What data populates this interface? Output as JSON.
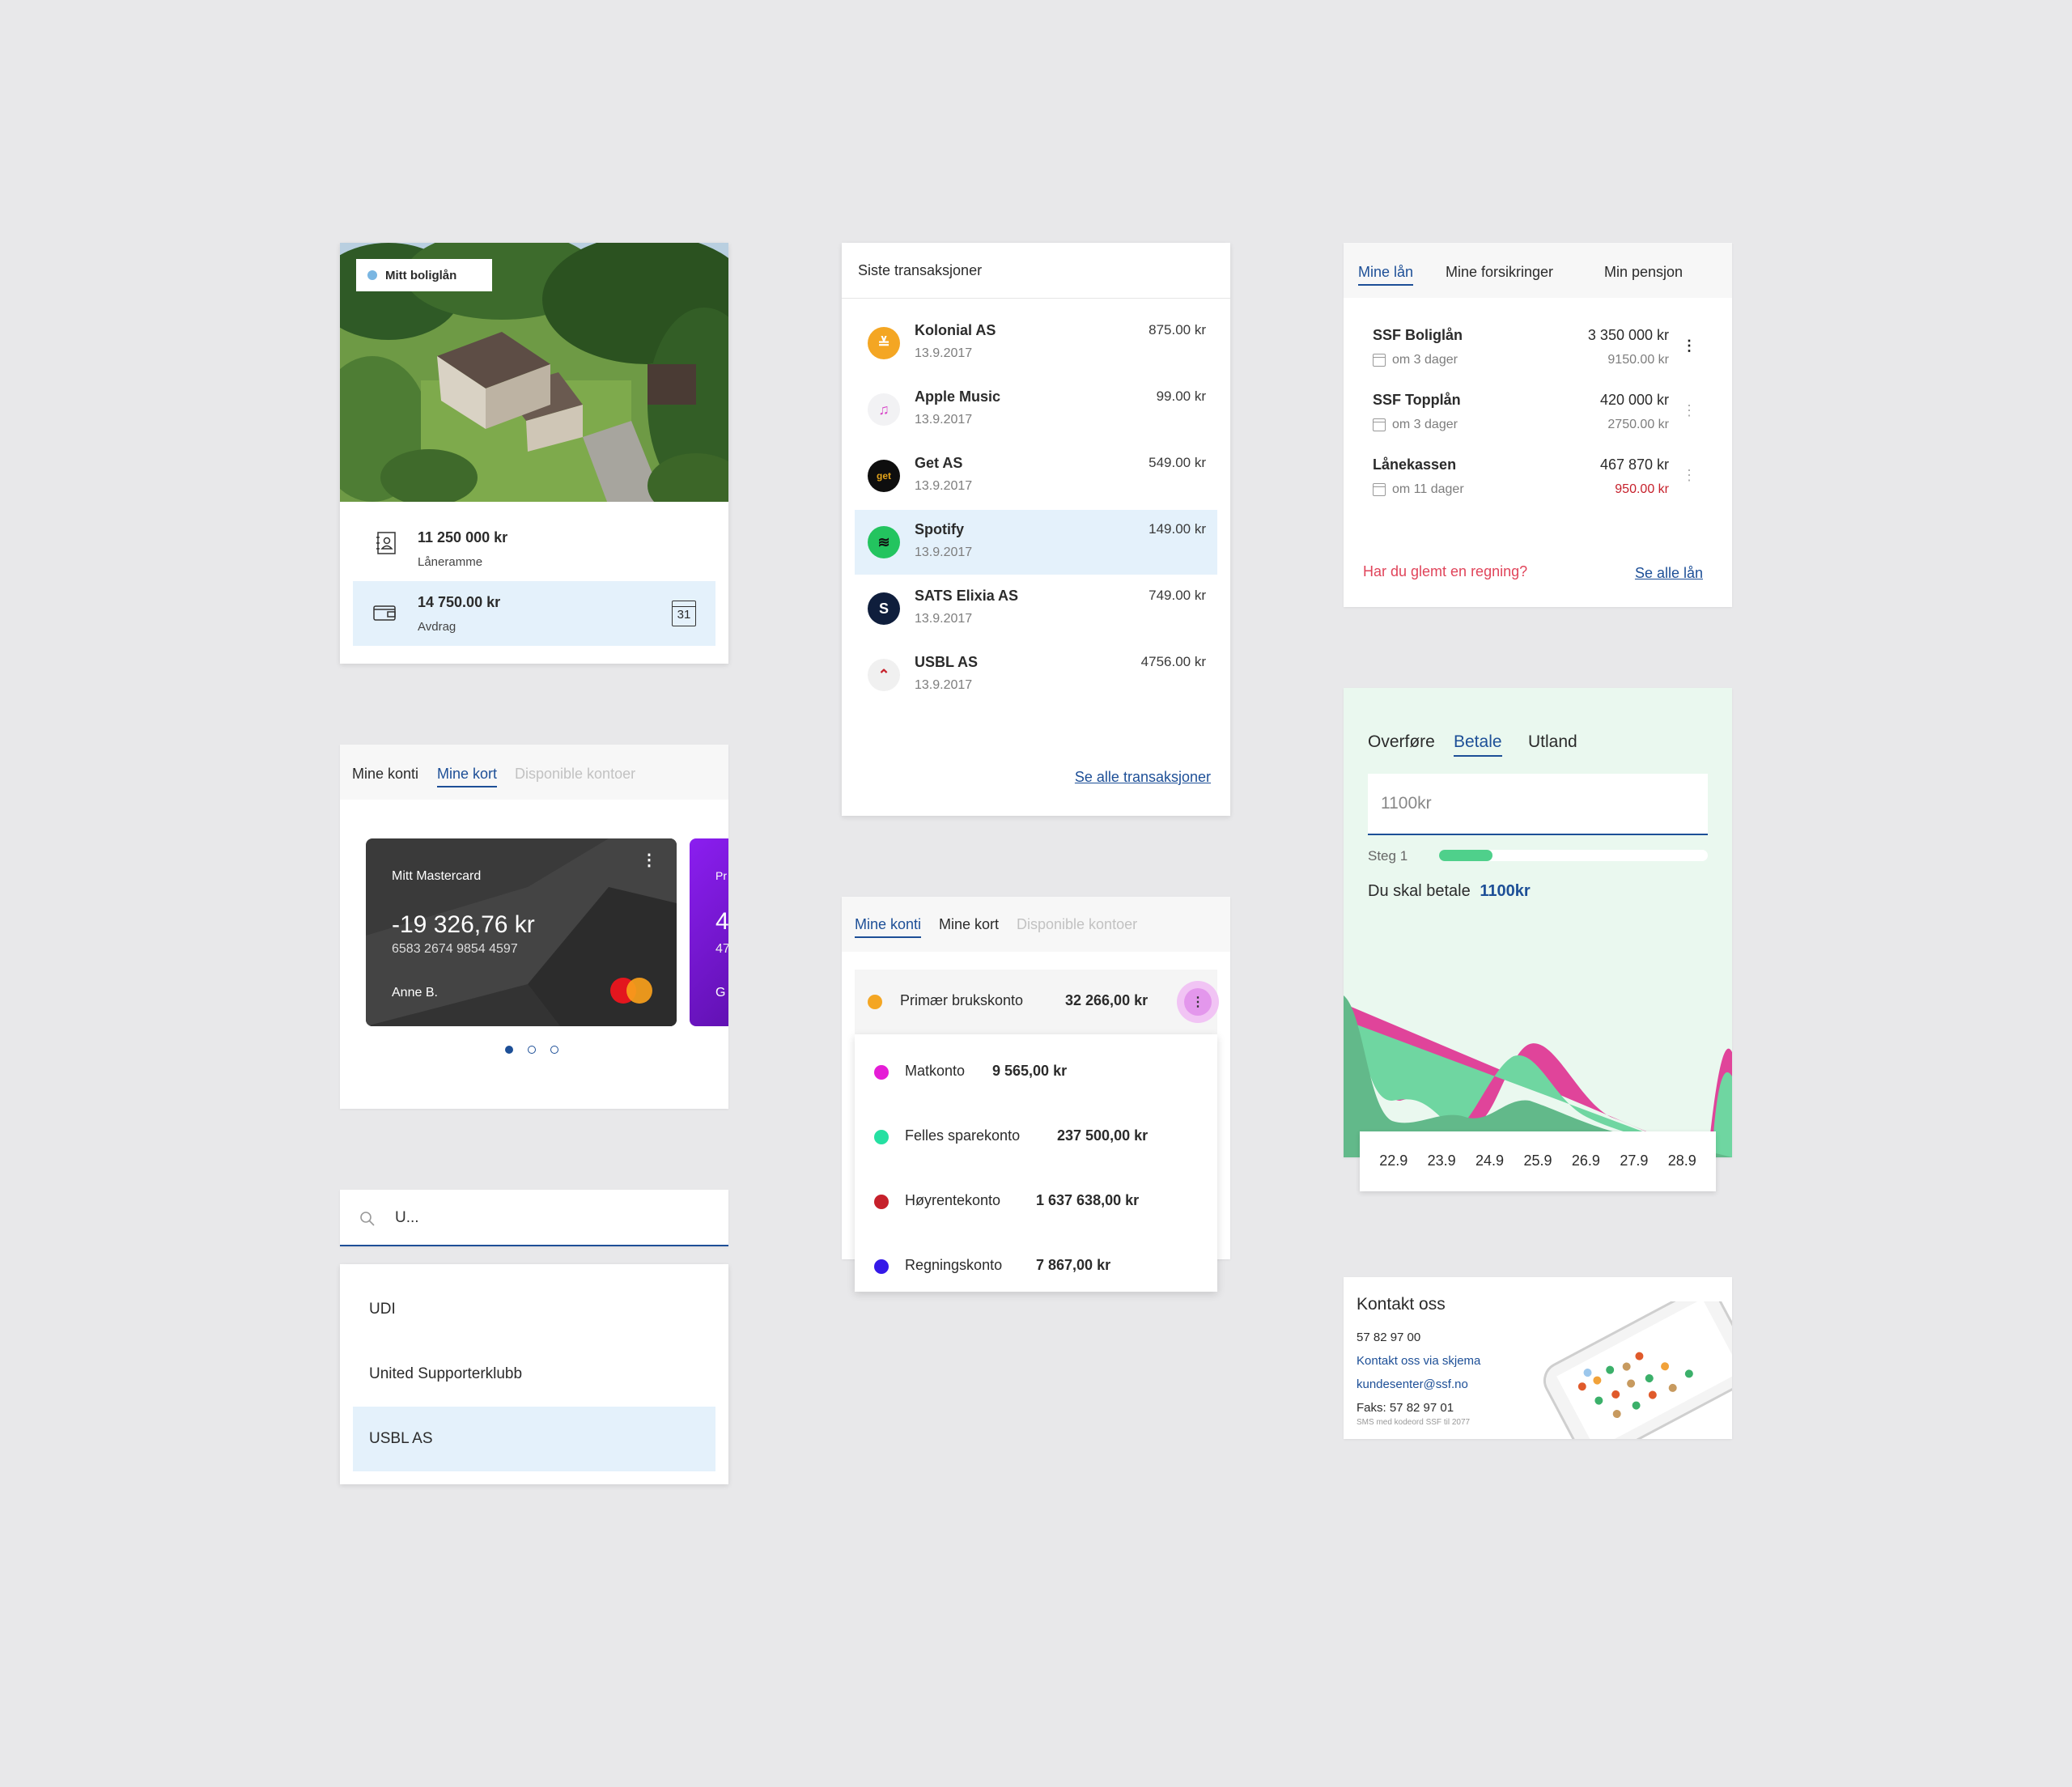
{
  "mortgage": {
    "tag": "Mitt boliglån",
    "frame_amount": "11 250 000 kr",
    "frame_label": "Låneramme",
    "installment_amount": "14 750.00 kr",
    "installment_label": "Avdrag",
    "calendar_day": "31",
    "colors": {
      "tag_dot": "#7ab6e2",
      "highlight": "#e4f1fb"
    }
  },
  "transactions": {
    "title": "Siste transaksjoner",
    "items": [
      {
        "name": "Kolonial AS",
        "date": "13.9.2017",
        "amount": "875.00 kr",
        "logo_color": "#f4a623",
        "logo_text": "≚",
        "icon": "kolonial-logo"
      },
      {
        "name": "Apple Music",
        "date": "13.9.2017",
        "amount": "99.00 kr",
        "logo_color": "#f2f2f4",
        "logo_text": "♫",
        "icon": "apple-music-logo"
      },
      {
        "name": "Get AS",
        "date": "13.9.2017",
        "amount": "549.00 kr",
        "logo_color": "#0e0e0e",
        "logo_text": "get",
        "icon": "get-logo"
      },
      {
        "name": "Spotify",
        "date": "13.9.2017",
        "amount": "149.00 kr",
        "logo_color": "#23c45f",
        "logo_text": "≋",
        "icon": "spotify-logo"
      },
      {
        "name": "SATS Elixia AS",
        "date": "13.9.2017",
        "amount": "749.00 kr",
        "logo_color": "#0f1e3c",
        "logo_text": "S",
        "icon": "sats-logo"
      },
      {
        "name": "USBL AS",
        "date": "13.9.2017",
        "amount": "4756.00 kr",
        "logo_color": "#f0f0f0",
        "logo_text": "⌃",
        "icon": "usbl-logo"
      }
    ],
    "see_all": "Se alle transaksjoner"
  },
  "loans": {
    "tabs": [
      "Mine lån",
      "Mine forsikringer",
      "Min pensjon"
    ],
    "items": [
      {
        "name": "SSF Boliglån",
        "due": "om 3 dager",
        "amount": "3 350 000 kr",
        "payment": "9150.00 kr"
      },
      {
        "name": "SSF Topplån",
        "due": "om 3 dager",
        "amount": "420 000 kr",
        "payment": "2750.00 kr"
      },
      {
        "name": "Lånekassen",
        "due": "om 11 dager",
        "amount": "467 870 kr",
        "payment": "950.00 kr"
      }
    ],
    "forgot": "Har du glemt en regning?",
    "see_all": "Se alle lån",
    "colors": {
      "overdue": "#c6202b",
      "forgot": "#e0445a"
    }
  },
  "cards_widget": {
    "tabs": [
      "Mine konti",
      "Mine kort",
      "Disponible kontoer"
    ],
    "card": {
      "name": "Mitt Mastercard",
      "balance": "-19 326,76 kr",
      "number": "6583 2674 9854 4597",
      "holder": "Anne B."
    },
    "peek_card": {
      "label": "Pr",
      "digit": "4",
      "sub": "47",
      "initial": "G"
    },
    "pager_count": 3
  },
  "payment": {
    "tabs": [
      "Overføre",
      "Betale",
      "Utland"
    ],
    "input_value": "1100kr",
    "step_label": "Steg 1",
    "step_progress": 0.2,
    "pay_text": "Du skal betale",
    "pay_amount": "1100kr",
    "chart_dates": [
      "22.9",
      "23.9",
      "24.9",
      "25.9",
      "26.9",
      "27.9",
      "28.9"
    ],
    "colors": {
      "bg": "#eaf8ef",
      "green": "#62b98a",
      "mint": "#6fd6a1",
      "pink": "#e0449a",
      "progress": "#4fd08b"
    }
  },
  "accounts": {
    "tabs": [
      "Mine konti",
      "Mine kort",
      "Disponible kontoer"
    ],
    "primary": {
      "name": "Primær brukskonto",
      "amount": "32 266,00 kr",
      "color": "#f4a623"
    },
    "items": [
      {
        "name": "Matkonto",
        "amount": "9 565,00 kr",
        "color": "#e51dd6"
      },
      {
        "name": "Felles sparekonto",
        "amount": "237 500,00 kr",
        "color": "#25e0a2"
      },
      {
        "name": "Høyrentekonto",
        "amount": "1 637 638,00 kr",
        "color": "#c6202b"
      },
      {
        "name": "Regningskonto",
        "amount": "7 867,00 kr",
        "color": "#3519e8"
      }
    ]
  },
  "search": {
    "query": "U...",
    "results": [
      "UDI",
      "United Supporterklubb",
      "USBL AS"
    ]
  },
  "contact": {
    "title": "Kontakt oss",
    "phone": "57 82 97 00",
    "form_link": "Kontakt oss via skjema",
    "email": "kundesenter@ssf.no",
    "fax": "Faks: 57 82 97 01",
    "sms": "SMS med kodeord SSF til 2077"
  }
}
